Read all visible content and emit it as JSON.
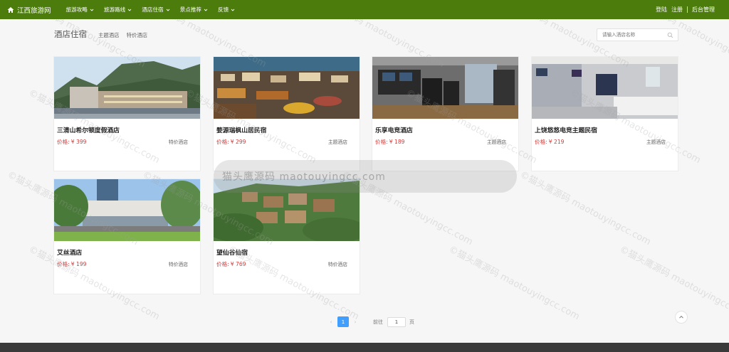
{
  "header": {
    "logo_text": "江西旅游网",
    "nav": [
      {
        "label": "旅游攻略"
      },
      {
        "label": "旅游路线"
      },
      {
        "label": "酒店住宿"
      },
      {
        "label": "景点推荐"
      },
      {
        "label": "反馈"
      }
    ],
    "login": "登陆",
    "register": "注册",
    "admin": "后台管理"
  },
  "page": {
    "title": "酒店住宿",
    "subnav": [
      "主题酒店",
      "特价酒店"
    ],
    "search_placeholder": "请输入酒店名称"
  },
  "price_label": "价格:",
  "hotels": [
    {
      "name": "三清山希尔顿度假酒店",
      "price": "¥ 399",
      "tag": "特价酒店"
    },
    {
      "name": "婺源瑞枫山居民宿",
      "price": "¥ 299",
      "tag": "主题酒店"
    },
    {
      "name": "乐享电竞酒店",
      "price": "¥ 189",
      "tag": "主题酒店"
    },
    {
      "name": "上饶悠悠电竞主题民宿",
      "price": "¥ 219",
      "tag": "主题酒店"
    },
    {
      "name": "艾丝酒店",
      "price": "¥ 199",
      "tag": "特价酒店"
    },
    {
      "name": "望仙谷仙宿",
      "price": "¥ 769",
      "tag": "特价酒店"
    }
  ],
  "overlay_text": "猫头鹰源码 maotouyingcc.com",
  "pagination": {
    "current": "1",
    "goto_label": "前往",
    "page_value": "1",
    "unit": "页"
  },
  "watermark": "©猫头鹰源码 maotouyingcc.com",
  "colors": {
    "nav_bg": "#4b7c0c",
    "price": "#d43b3b",
    "page_active": "#409eff"
  }
}
